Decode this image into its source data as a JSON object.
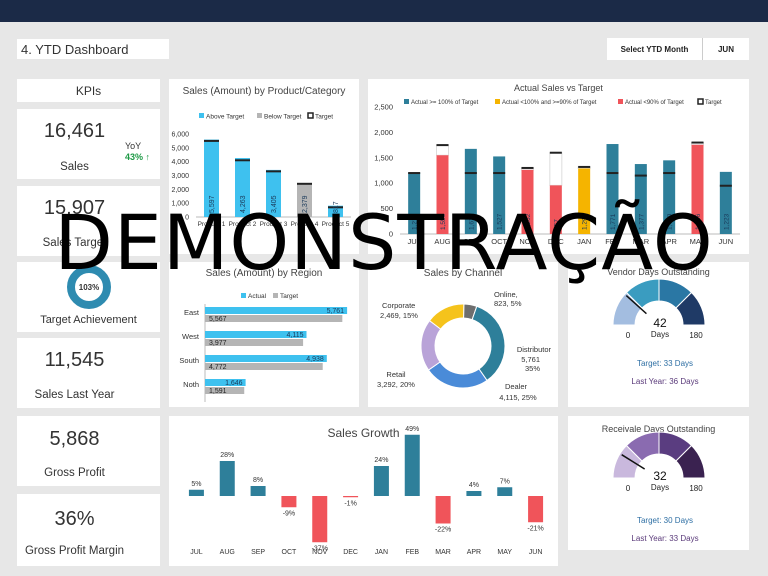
{
  "page": {
    "title": "4. YTD Dashboard",
    "select_label": "Select YTD Month",
    "select_value": "JUN",
    "watermark": "DEMONSTRAÇÃO"
  },
  "kpis": {
    "header": "KPIs",
    "sales": {
      "value": "16,461",
      "label": "Sales",
      "yoy_label": "YoY",
      "yoy_value": "43%"
    },
    "sales_target": {
      "value": "15,907",
      "label": "Sales Target"
    },
    "achievement": {
      "value": "103%",
      "label": "Target Achievement"
    },
    "sales_last_year": {
      "value": "11,545",
      "label": "Sales Last Year"
    },
    "gross_profit": {
      "value": "5,868",
      "label": "Gross Profit"
    },
    "gross_profit_margin": {
      "value": "36%",
      "label": "Gross Profit Margin"
    }
  },
  "colors": {
    "actual_high": "#2e7f9a",
    "actual_mid": "#f5b400",
    "actual_low": "#f0545a",
    "above": "#3ec1ef",
    "below": "#b5b5b5",
    "positive": "#2e7f9a",
    "negative": "#f0545a",
    "donut_yoy": "#2e8bb0"
  },
  "chart_data": [
    {
      "id": "product",
      "type": "bar",
      "title": "Sales (Amount) by Product/Category",
      "legend": [
        "Above Target",
        "Below Target",
        "Target"
      ],
      "categories": [
        "Product 1",
        "Product 2",
        "Product 3",
        "Product 4",
        "Product 5"
      ],
      "values": [
        5597,
        4263,
        3405,
        2379,
        817
      ],
      "value_labels": [
        "5,597",
        "4,263",
        "3,405",
        "2,379",
        "817"
      ],
      "targets": [
        5500,
        4100,
        3300,
        2400,
        700
      ],
      "status": [
        "above",
        "above",
        "above",
        "below",
        "above"
      ],
      "ylim": [
        0,
        6000
      ],
      "yticks": [
        "0",
        "1,000",
        "2,000",
        "3,000",
        "4,000",
        "5,000",
        "6,000"
      ]
    },
    {
      "id": "monthly",
      "type": "bar",
      "title": "Actual Sales vs Target",
      "legend": [
        "Actual >= 100% of Target",
        "Actual <100% and >=90% of Target",
        "Actual <90% of Target",
        "Target"
      ],
      "categories": [
        "JUL",
        "AUG",
        "SEP",
        "OCT",
        "NOV",
        "DEC",
        "JAN",
        "FEB",
        "MAR",
        "APR",
        "MAY",
        "JUN"
      ],
      "values": [
        1210,
        1550,
        1676,
        1527,
        1262,
        957,
        1290,
        1771,
        1377,
        1450,
        1756,
        1223
      ],
      "value_labels": [
        "1,210",
        "1,550",
        "1,676",
        "1,527",
        "1,262",
        "957",
        "1,290",
        "1,771",
        "1,377",
        "1,450",
        "1,756",
        "1,223"
      ],
      "targets": [
        1200,
        1750,
        1200,
        1200,
        1300,
        1600,
        1320,
        1200,
        1150,
        1200,
        1800,
        950
      ],
      "status": [
        "high",
        "low",
        "high",
        "high",
        "low",
        "low",
        "mid",
        "high",
        "high",
        "high",
        "low",
        "high"
      ],
      "ylim": [
        0,
        2500
      ],
      "yticks": [
        "0",
        "500",
        "1,000",
        "1,500",
        "2,000",
        "2,500"
      ]
    },
    {
      "id": "region",
      "type": "bar",
      "title": "Sales (Amount) by Region",
      "legend": [
        "Actual",
        "Target"
      ],
      "categories": [
        "East",
        "West",
        "South",
        "Noth"
      ],
      "actual": [
        5761,
        4115,
        4938,
        1646
      ],
      "actual_labels": [
        "5,761",
        "4,115",
        "4,938",
        "1,646"
      ],
      "target": [
        5567,
        3977,
        4772,
        1591
      ],
      "target_labels": [
        "5,567",
        "3,977",
        "4,772",
        "1,591"
      ],
      "xlim": [
        0,
        6000
      ]
    },
    {
      "id": "channel",
      "type": "pie",
      "title": "Sales by Channel",
      "slices": [
        {
          "name": "Online",
          "value": 823,
          "label": "Online,",
          "sub": "823, 5%",
          "color": "#6e6e6e"
        },
        {
          "name": "Distributor",
          "value": 5761,
          "label": "Distributor",
          "sub": "5,761",
          "sub2": "35%",
          "color": "#2e7f9a"
        },
        {
          "name": "Dealer",
          "value": 4115,
          "label": "Dealer",
          "sub": "4,115, 25%",
          "color": "#4a8bd8"
        },
        {
          "name": "Retail",
          "value": 3292,
          "label": "Retail",
          "sub": "3,292, 20%",
          "color": "#b9a3d8"
        },
        {
          "name": "Corporate",
          "value": 2469,
          "label": "Corporate",
          "sub": "2,469, 15%",
          "color": "#f5c31c"
        }
      ]
    },
    {
      "id": "growth",
      "type": "bar",
      "title": "Sales Growth",
      "categories": [
        "JUL",
        "AUG",
        "SEP",
        "OCT",
        "NOV",
        "DEC",
        "JAN",
        "FEB",
        "MAR",
        "APR",
        "MAY",
        "JUN"
      ],
      "values": [
        5,
        28,
        8,
        -9,
        -37,
        -1,
        24,
        49,
        -22,
        4,
        7,
        -21
      ],
      "value_labels": [
        "5%",
        "28%",
        "8%",
        "-9%",
        "-37%",
        "-1%",
        "24%",
        "49%",
        "-22%",
        "4%",
        "7%",
        "-21%"
      ]
    }
  ],
  "gauges": [
    {
      "id": "payable",
      "title": "Vendor Days Outstanding",
      "value": 42,
      "value_text": "42",
      "unit": "Days",
      "min_label": "0",
      "max_label": "180",
      "max": 180,
      "colors": [
        "#a3bde0",
        "#3a9cc0",
        "#2a77a4",
        "#1f3a66"
      ],
      "target": "Target: 33 Days",
      "last_year": "Last Year: 36 Days",
      "target_color": "#2e6fa4",
      "last_year_color": "#5a3a7a"
    },
    {
      "id": "receivable",
      "title": "Receivale Days Outstanding",
      "value": 32,
      "value_text": "32",
      "unit": "Days",
      "min_label": "0",
      "max_label": "180",
      "max": 180,
      "colors": [
        "#c9b8dd",
        "#8a6bb0",
        "#5a3d80",
        "#3a2250"
      ],
      "target": "Target: 30 Days",
      "last_year": "Last Year: 33 Days",
      "target_color": "#2e6fa4",
      "last_year_color": "#5a3a7a"
    }
  ]
}
